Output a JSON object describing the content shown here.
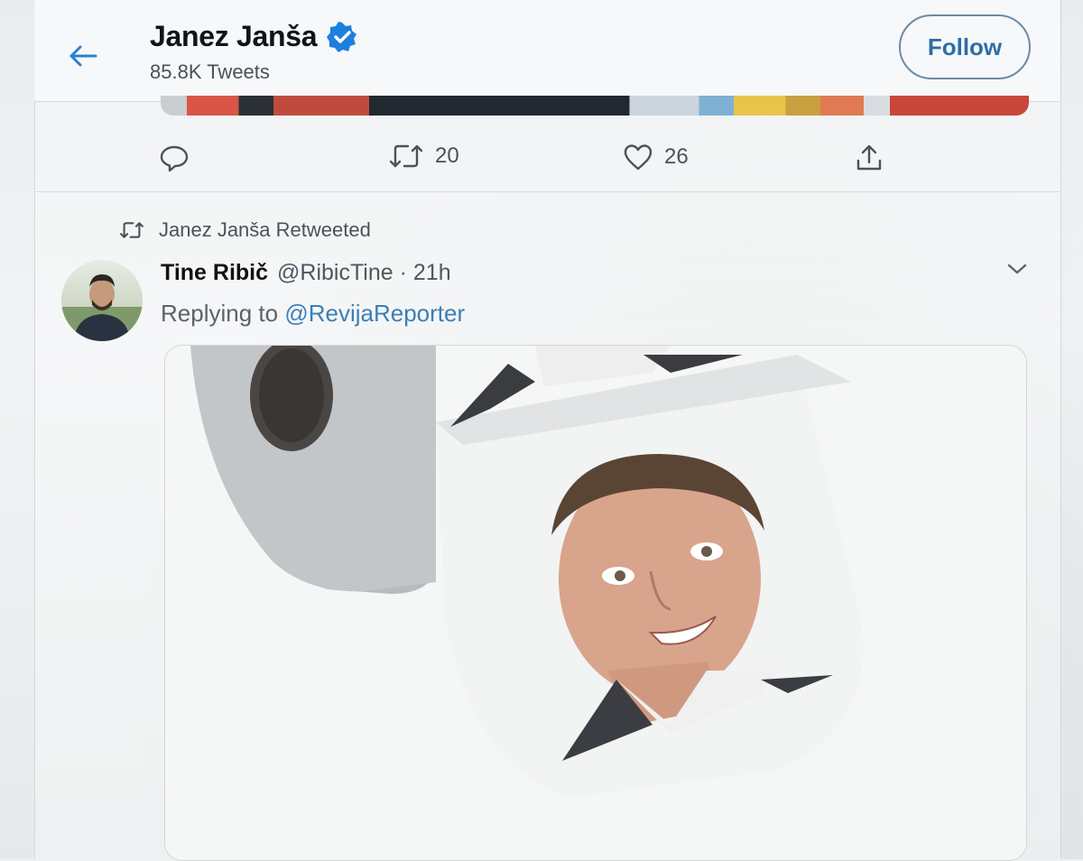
{
  "header": {
    "title": "Janez Janša",
    "tweet_count": "85.8K Tweets",
    "follow_label": "Follow"
  },
  "prev_tweet": {
    "retweets": "20",
    "likes": "26"
  },
  "tweet": {
    "retweeted_by": "Janez Janša Retweeted",
    "author_name": "Tine Ribič",
    "author_handle": "@RibicTine · 21h",
    "replying_prefix": "Replying to",
    "replying_to": "@RevijaReporter"
  },
  "colors": {
    "accent": "#1d9bf0",
    "link": "#3b7fb8",
    "text_secondary": "#4a5259"
  },
  "icons": [
    "back-arrow-icon",
    "verified-badge-icon",
    "reply-icon",
    "retweet-icon",
    "like-icon",
    "share-icon",
    "chevron-down-icon"
  ]
}
